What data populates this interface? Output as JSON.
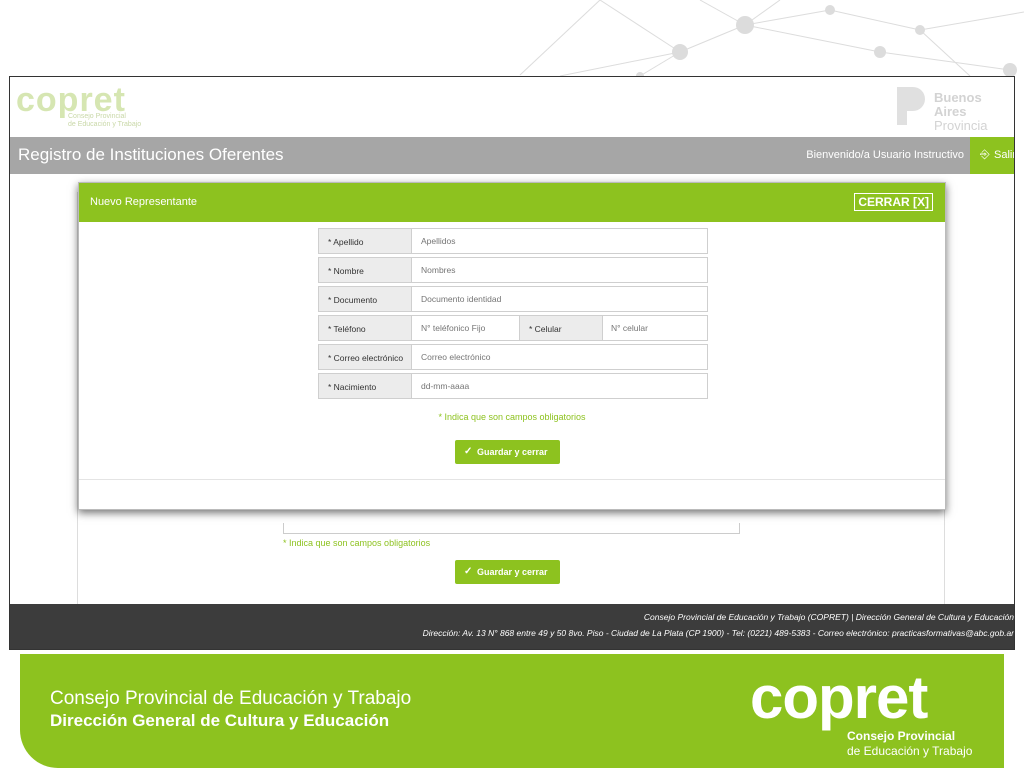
{
  "header": {
    "logo_text": "copret",
    "logo_subtitle_1": "Consejo Provincial",
    "logo_subtitle_2": "de Educación y Trabajo",
    "province_line1": "Buenos Aires",
    "province_line2": "Provincia"
  },
  "titlebar": {
    "title": "Registro de Instituciones Oferentes",
    "welcome": "Bienvenido/a Usuario Instructivo",
    "exit_label": "Salir"
  },
  "background_form": {
    "required_note": "* Indica que son campos obligatorios",
    "save_label": "Guardar y cerrar"
  },
  "modal": {
    "title": "Nuevo Representante",
    "close_label": "CERRAR [X]",
    "fields": {
      "apellido": {
        "label": "* Apellido",
        "placeholder": "Apellidos"
      },
      "nombre": {
        "label": "* Nombre",
        "placeholder": "Nombres"
      },
      "documento": {
        "label": "* Documento",
        "placeholder": "Documento identidad"
      },
      "telefono": {
        "label": "* Teléfono",
        "placeholder": "N° teléfonico Fijo"
      },
      "celular": {
        "label": "* Celular",
        "placeholder": "N° celular"
      },
      "correo": {
        "label": "* Correo electrónico",
        "placeholder": "Correo electrónico"
      },
      "nacimiento": {
        "label": "* Nacimiento",
        "placeholder": "dd-mm-aaaa"
      }
    },
    "required_note": "* Indica que son campos obligatorios",
    "save_label": "Guardar y cerrar"
  },
  "site_footer": {
    "line1": "Consejo Provincial de Educación y Trabajo (COPRET) | Dirección General de Cultura y Educación",
    "line2": "Dirección: Av. 13 N° 868 entre 49 y 50 8vo. Piso - Ciudad de La Plata (CP 1900) - Tel: (0221) 489-5383 - Correo electrónico: practicasformativas@abc.gob.ar"
  },
  "slide_footer": {
    "line1": "Consejo Provincial de Educación y Trabajo",
    "line2": "Dirección General de Cultura y Educación",
    "logo_text": "copret",
    "logo_sub1": "Consejo Provincial",
    "logo_sub2": "de Educación y Trabajo"
  },
  "colors": {
    "accent": "#8dc21f",
    "titlebar": "#a6a6a6",
    "footer": "#3c3c3c"
  }
}
